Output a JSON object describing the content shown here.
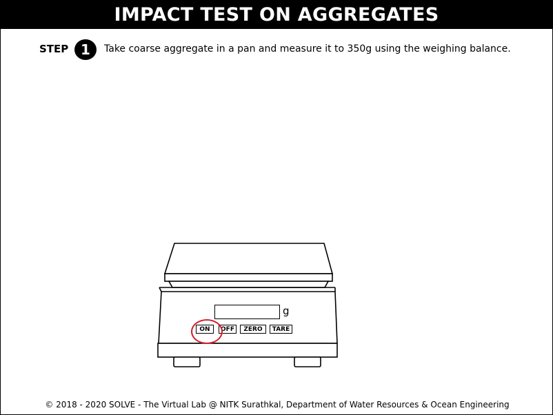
{
  "header": {
    "title": "IMPACT TEST ON AGGREGATES"
  },
  "step": {
    "label": "STEP",
    "number": "1",
    "instruction": "Take coarse aggregate in a pan and measure it to 350g using the weighing balance."
  },
  "balance": {
    "unit": "g",
    "display_value": "",
    "buttons": {
      "on": "ON",
      "off": "OFF",
      "zero": "ZERO",
      "tare": "TARE"
    },
    "highlight_color": "#d21f2a"
  },
  "footer": {
    "text": "© 2018 - 2020 SOLVE - The Virtual Lab @ NITK Surathkal, Department of Water Resources & Ocean Engineering"
  }
}
